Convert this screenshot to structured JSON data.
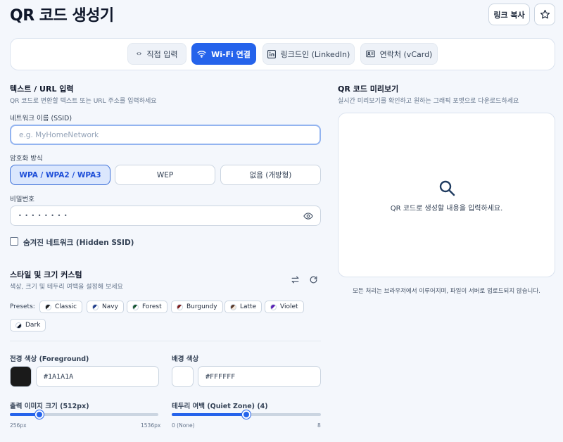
{
  "header": {
    "title": "QR 코드 생성기",
    "copy_link": "링크 복사",
    "star_icon": "star-icon"
  },
  "tabs": [
    {
      "label": "직접 입력",
      "icon": "code-icon"
    },
    {
      "label": "Wi-Fi 연결",
      "icon": "wifi-icon"
    },
    {
      "label": "링크드인 (LinkedIn)",
      "icon": "linkedin-icon"
    },
    {
      "label": "연락처 (vCard)",
      "icon": "contact-card-icon"
    }
  ],
  "input_section": {
    "title": "텍스트 / URL 입력",
    "subtitle": "QR 코드로 변환할 텍스트 또는 URL 주소를 입력하세요"
  },
  "ssid": {
    "label": "네트워크 이름 (SSID)",
    "placeholder": "e.g. MyHomeNetwork"
  },
  "encryption": {
    "label": "암호화 방식",
    "options": [
      "WPA / WPA2 / WPA3",
      "WEP",
      "없음 (개방형)"
    ],
    "selected": "WPA / WPA2 / WPA3"
  },
  "password": {
    "label": "비밀번호",
    "placeholder": "• • • • • • • •"
  },
  "hidden_ssid": {
    "label": "숨겨진 네트워크 (Hidden SSID)",
    "checked": false
  },
  "style_section": {
    "title": "스타일 및 크기 커스텀",
    "subtitle": "색상, 크기 및 테두리 여백을 설정해 보세요"
  },
  "presets": {
    "label": "Presets:",
    "items": [
      {
        "name": "Classic",
        "fg": "#1a1a1a",
        "bg": "#ffffff"
      },
      {
        "name": "Navy",
        "fg": "#1e3a8a",
        "bg": "#ffffff"
      },
      {
        "name": "Forest",
        "fg": "#14532d",
        "bg": "#ffffff"
      },
      {
        "name": "Burgundy",
        "fg": "#7f1d1d",
        "bg": "#ffffff"
      },
      {
        "name": "Latte",
        "fg": "#5b3a29",
        "bg": "#f5e9dc"
      },
      {
        "name": "Violet",
        "fg": "#5b21b6",
        "bg": "#ffffff"
      },
      {
        "name": "Dark",
        "fg": "#ffffff",
        "bg": "#111827"
      }
    ]
  },
  "foreground": {
    "label": "전경 색상 (Foreground)",
    "value": "#1A1A1A"
  },
  "background": {
    "label": "배경 색상",
    "value": "#FFFFFF"
  },
  "size_slider": {
    "label": "출력 이미지 크기 (512px)",
    "min_label": "256px",
    "max_label": "1536px",
    "min": 256,
    "max": 1536,
    "value": 512
  },
  "margin_slider": {
    "label": "테두리 여백 (Quiet Zone) (4)",
    "min_label": "0 (None)",
    "max_label": "8",
    "min": 0,
    "max": 8,
    "value": 4
  },
  "preview_section": {
    "title": "QR 코드 미리보기",
    "subtitle": "실시간 미리보기를 확인하고 원하는 그래픽 포맷으로 다운로드하세요",
    "empty_message": "QR 코드로 생성할 내용을 입력하세요.",
    "footer": "모든 처리는 브라우저에서 이루어지며, 파일이 서버로 업로드되지 않습니다."
  },
  "colors": {
    "accent": "#2563eb",
    "accent_light": "#dbe7fd"
  }
}
